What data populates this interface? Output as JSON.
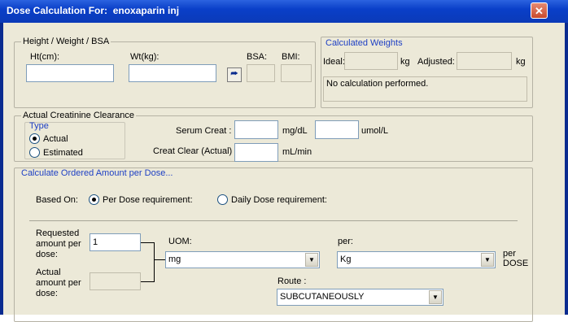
{
  "window": {
    "title": "Dose Calculation For:",
    "drug": "enoxaparin inj",
    "close_glyph": "✕"
  },
  "hwb": {
    "group_label": "Height / Weight / BSA",
    "ht_label": "Ht(cm):",
    "ht_value": "",
    "wt_label": "Wt(kg):",
    "wt_value": "",
    "bsa_label": "BSA:",
    "bmi_label": "BMI:",
    "calc_icon": "calculate-icon"
  },
  "calc_weights": {
    "group_label": "Calculated Weights",
    "ideal_label": "Ideal:",
    "unit1": "kg",
    "adjusted_label": "Adjusted:",
    "unit2": "kg",
    "message": "No calculation performed."
  },
  "crcl": {
    "group_label": "Actual Creatinine Clearance",
    "type_label": "Type",
    "opt_actual": "Actual",
    "opt_estimated": "Estimated",
    "serum_label": "Serum Creat :",
    "unit_mgdl": "mg/dL",
    "unit_umol": "umol/L",
    "clear_label": "Creat Clear (Actual)",
    "unit_mlmin": "mL/min"
  },
  "ordered": {
    "group_label": "Calculate Ordered Amount per Dose...",
    "based_on_label": "Based On:",
    "opt_per_dose": "Per Dose requirement:",
    "opt_daily": "Daily Dose requirement:",
    "requested_label_1": "Requested",
    "requested_label_2": "amount per",
    "requested_label_3": "dose:",
    "requested_value": "1",
    "actual_label_1": "Actual",
    "actual_label_2": "amount per",
    "actual_label_3": "dose:",
    "uom_label": "UOM:",
    "uom_value": "mg",
    "per_label": "per:",
    "per_value": "Kg",
    "per_dose_1": "per",
    "per_dose_2": "DOSE",
    "route_label": "Route :",
    "route_value": "SUBCUTANEOUSLY"
  }
}
